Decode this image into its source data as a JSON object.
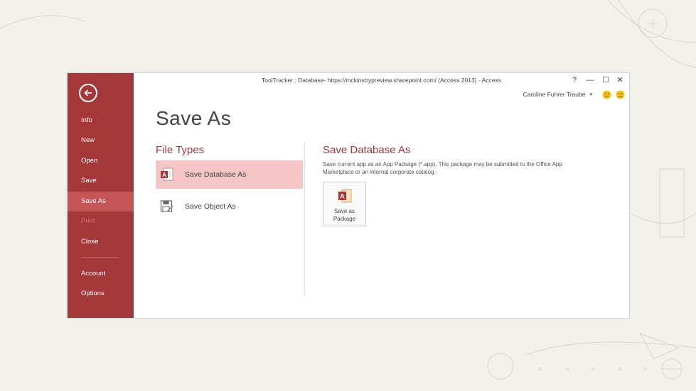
{
  "window": {
    "title": "ToolTracker : Database- https://mckinstrypreview.sharepoint.com/ (Access 2013) - Access",
    "controls": {
      "help": "?",
      "minimize": "—",
      "maximize": "☐",
      "close": "✕"
    },
    "user": {
      "name": "Caroline Fuhrer Traube",
      "dropdown": "▾"
    }
  },
  "sidebar": {
    "items": [
      {
        "label": "Info"
      },
      {
        "label": "New"
      },
      {
        "label": "Open"
      },
      {
        "label": "Save"
      },
      {
        "label": "Save As",
        "active": true
      },
      {
        "label": "Print",
        "disabled": true
      },
      {
        "label": "Close"
      },
      {
        "label": "Account"
      },
      {
        "label": "Options"
      }
    ]
  },
  "main": {
    "title": "Save As",
    "file_types": {
      "heading": "File Types",
      "items": [
        {
          "label": "Save Database As",
          "icon": "access-database-icon",
          "selected": true
        },
        {
          "label": "Save Object As",
          "icon": "save-object-icon"
        }
      ]
    },
    "save_database_as": {
      "heading": "Save Database As",
      "description": "Save current app as an App Package (*.app). This package may be submitted to the Office App Marketplace or an internal corporate catalog.",
      "tile": {
        "label": "Save as\nPackage",
        "icon": "access-package-icon"
      }
    }
  },
  "colors": {
    "accent": "#a4373a",
    "sidebar_active": "#c65558",
    "selection": "#f6c5c6",
    "background": "#f3f1ec"
  }
}
